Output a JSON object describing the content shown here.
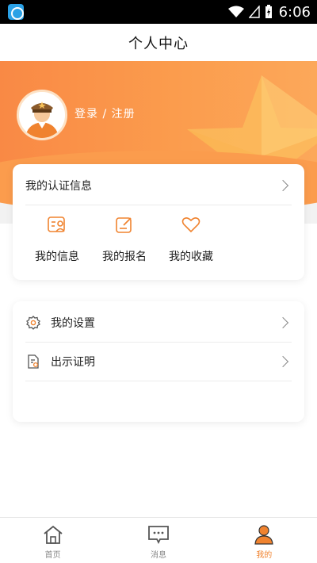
{
  "status_bar": {
    "time": "6:06",
    "icons": [
      "wifi-icon",
      "cell-signal-icon",
      "battery-charging-icon"
    ]
  },
  "header": {
    "title": "个人中心"
  },
  "profile": {
    "login_text": "登录 / 注册",
    "avatar": "police-officer-avatar"
  },
  "auth_card": {
    "title": "我的认证信息",
    "actions": [
      {
        "label": "我的信息",
        "icon": "id-card-icon"
      },
      {
        "label": "我的报名",
        "icon": "edit-form-icon"
      },
      {
        "label": "我的收藏",
        "icon": "heart-icon"
      }
    ]
  },
  "settings_card": {
    "items": [
      {
        "label": "我的设置",
        "icon": "gear-icon"
      },
      {
        "label": "出示证明",
        "icon": "certificate-icon"
      }
    ]
  },
  "bottom_nav": {
    "items": [
      {
        "label": "首页",
        "icon": "home-icon",
        "active": false
      },
      {
        "label": "消息",
        "icon": "message-icon",
        "active": false
      },
      {
        "label": "我的",
        "icon": "user-icon",
        "active": true
      }
    ]
  },
  "colors": {
    "accent": "#f0832f",
    "banner_start": "#f98945",
    "banner_end": "#fca85a"
  }
}
